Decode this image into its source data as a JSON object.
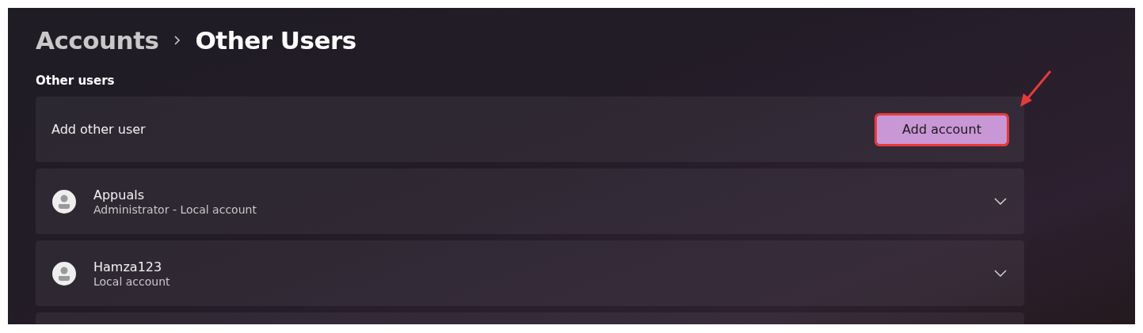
{
  "breadcrumb": [
    {
      "label": "Accounts",
      "current": false
    },
    {
      "label": "Other Users",
      "current": true
    }
  ],
  "section_title": "Other users",
  "add_user": {
    "label": "Add other user",
    "button": {
      "label": "Add account",
      "highlighted": true
    }
  },
  "users": [
    {
      "name": "Appuals",
      "subtitle": "Administrator - Local account",
      "expandable": true
    },
    {
      "name": "Hamza123",
      "subtitle": "Local account",
      "expandable": true
    }
  ],
  "more_cards_below": true
}
